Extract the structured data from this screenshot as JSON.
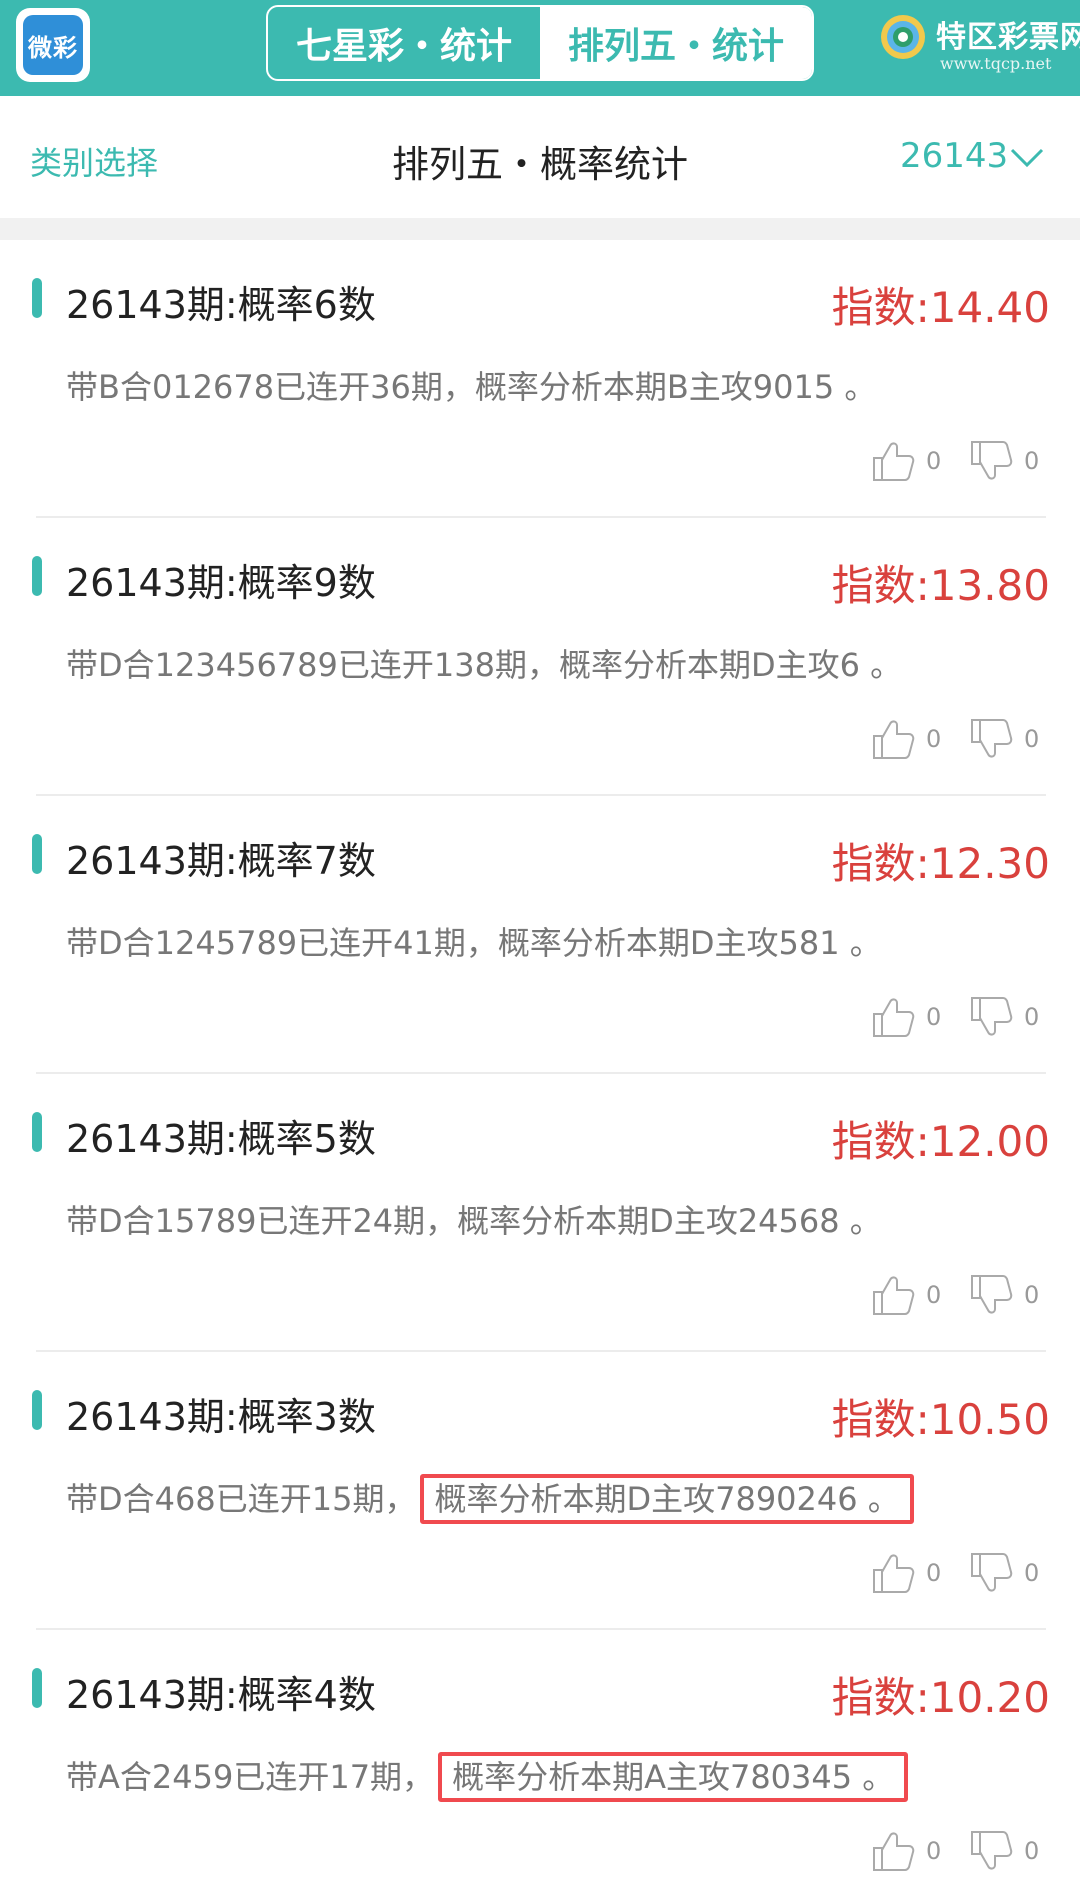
{
  "header": {
    "app_logo_text": "微彩",
    "tabs": [
      {
        "label": "七星彩・统计"
      },
      {
        "label": "排列五・统计"
      }
    ],
    "brand_name": "特区彩票网",
    "brand_url": "www.tqcp.net"
  },
  "subheader": {
    "category_select": "类别选择",
    "title": "排列五・概率统计",
    "issue": "26143"
  },
  "cards": [
    {
      "title": "26143期:概率6数",
      "index": "指数:14.40",
      "desc_pre": "带B合012678已连开36期，",
      "desc_main": "概率分析本期B主攻9015 。",
      "likes": "0",
      "dislikes": "0"
    },
    {
      "title": "26143期:概率9数",
      "index": "指数:13.80",
      "desc_pre": "带D合123456789已连开138期，",
      "desc_main": "概率分析本期D主攻6 。",
      "likes": "0",
      "dislikes": "0"
    },
    {
      "title": "26143期:概率7数",
      "index": "指数:12.30",
      "desc_pre": "带D合1245789已连开41期，",
      "desc_main": "概率分析本期D主攻581 。",
      "likes": "0",
      "dislikes": "0"
    },
    {
      "title": "26143期:概率5数",
      "index": "指数:12.00",
      "desc_pre": "带D合15789已连开24期，",
      "desc_main": "概率分析本期D主攻24568 。",
      "likes": "0",
      "dislikes": "0"
    },
    {
      "title": "26143期:概率3数",
      "index": "指数:10.50",
      "desc_pre": "带D合468已连开15期，",
      "desc_main": "概率分析本期D主攻7890246 。",
      "likes": "0",
      "dislikes": "0"
    },
    {
      "title": "26143期:概率4数",
      "index": "指数:10.20",
      "desc_pre": "带A合2459已连开17期，",
      "desc_main": "概率分析本期A主攻780345 。",
      "likes": "0",
      "dislikes": "0"
    }
  ],
  "colors": {
    "accent": "#3cbab0",
    "index_red": "#d9413d",
    "highlight_border": "#f04a4f"
  }
}
